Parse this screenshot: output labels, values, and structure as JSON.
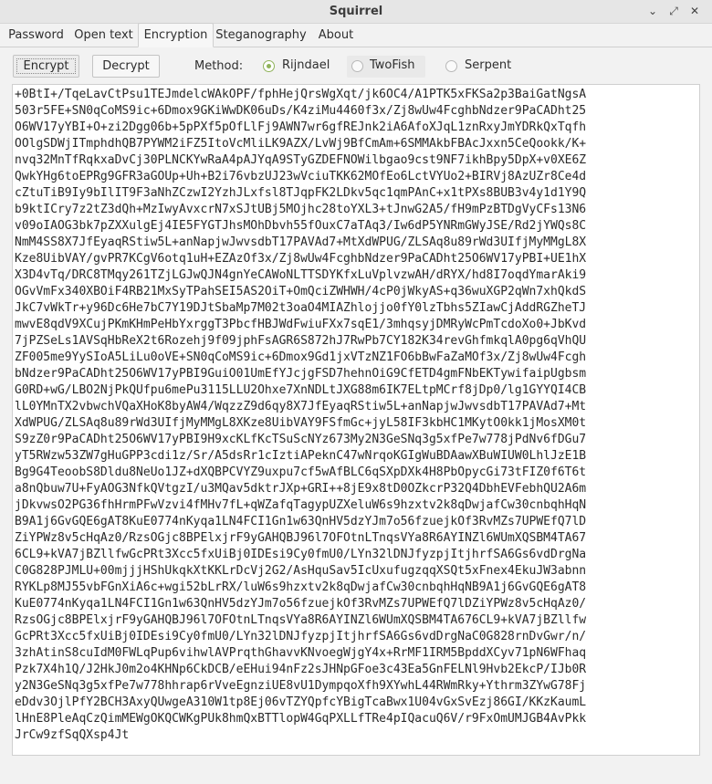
{
  "window": {
    "title": "Squirrel",
    "controls": [
      "chevron-down-icon",
      "restore-icon",
      "close-icon"
    ]
  },
  "tabs": [
    "Password",
    "Open text",
    "Encryption",
    "Steganography",
    "About"
  ],
  "active_tab": "Encryption",
  "toolbar": {
    "encrypt_label": "Encrypt",
    "decrypt_label": "Decrypt",
    "method_label": "Method:",
    "methods": [
      {
        "label": "Rijndael",
        "checked": true
      },
      {
        "label": "TwoFish",
        "checked": false
      },
      {
        "label": "Serpent",
        "checked": false
      }
    ]
  },
  "accent_color": "#8fb35a",
  "ciphertext": [
    "+0BtI+/TqeLavCtPsu1TEJmdelcWAkOPF/fphHejQrsWgXqt/jk6OC4/A1PTK5xFKSa2p3BaiGatNgsA",
    "503r5FE+SN0qCoMS9ic+6Dmox9GKiWwDK06uDs/K4ziMu4460f3x/Zj8wUw4FcghbNdzer9PaCADht25",
    "O6WV17yYBI+O+zi2Dgg06b+5pPXf5pOfLlFj9AWN7wr6gfREJnk2iA6AfoXJqL1znRxyJmYDRkQxTqfh",
    "OOlgSDWjITmphdhQB7PYWM2iFZ5ItoVcMliLK9AZX/LvWj9BfCmAm+6SMMAkbFBAcJxxn5CeQookk/K+",
    "nvq32MnTfRqkxaDvCj30PLNCKYwRaA4pAJYqA9STyGZDEFNOWilbgao9cst9NF7ikhBpy5DpX+v0XE6Z",
    "QwkYHg6toEPRg9GFR3aGOUp+Uh+B2i76vbzUJ23wVciuTKK62MOfEo6LctVYUo2+BIRVj8AzUZr8Ce4d",
    "cZtuTiB9Iy9bIlIT9F3aNhZCzwI2YzhJLxfsl8TJqpFK2LDkv5qc1qmPAnC+x1tPXs8BUB3v4y1d1Y9Q",
    "b9ktICry7z2tZ3dQh+MzIwyAvxcrN7xSJtUBj5MOjhc28toYXL3+tJnwG2A5/fH9mPzBTDgVyCFs13N6",
    "v09oIAOG3bk7pZXXulgEj4IE5FYGTJhsMOhDbvh55fOuxC7aTAq3/Iw6dP5YNRmGWyJSE/Rd2jYWQs8C",
    "NmM4SS8X7JfEyaqRStiw5L+anNapjwJwvsdbT17PAVAd7+MtXdWPUG/ZLSAq8u89rWd3UIfjMyMMgL8X",
    "Kze8UibVAY/gvPR7KCgV6otq1uH+EZAzOf3x/Zj8wUw4FcghbNdzer9PaCADht25O6WV17yPBI+UE1hX",
    "X3D4vTq/DRC8TMqy261TZjLGJwQJN4gnYeCAWoNLTTSDYKfxLuVplvzwAH/dRYX/hd8I7oqdYmarAki9",
    "OGvVmFx340XBOiF4RB21MxSyTPahSEI5AS2OiT+OmQciZWHWH/4cP0jWkyAS+q36wuXGP2qWn7xhQkdS",
    "JkC7vWkTr+y96Dc6He7bC7Y19DJtSbaMp7M02t3oaO4MIAZhlojjo0fY0lzTbhs5ZIawCjAddRGZheTJ",
    "mwvE8qdV9XCujPKmKHmPeHbYxrggT3PbcfHBJWdFwiuFXx7sqE1/3mhqsyjDMRyWcPmTcdoXo0+JbKvd",
    "7jPZSeLs1AVSqHbReX2t6Rozehj9f09jphFsAGR6S872hJ7RwPb7CY182K34revGhfmkqlA0pg6qVhQU",
    "ZF005me9YySIoA5LiLu0oVE+SN0qCoMS9ic+6Dmox9Gd1jxVTzNZ1FO6bBwFaZaMOf3x/Zj8wUw4Fcgh",
    "bNdzer9PaCADht25O6WV17yPBI9GuiO01UmEfYJcjgFSD7hehnOiG9CfETD4gmFNbEKTywifaipUgbsm",
    "G0RD+wG/LBO2NjPkQUfpu6mePu3115LLU2Ohxe7XnNDLtJXG88m6IK7ELtpMCrf8jDp0/lg1GYYQI4CB",
    "lL0YMnTX2vbwchVQaXHoK8byAW4/WqzzZ9d6qy8X7JfEyaqRStiw5L+anNapjwJwvsdbT17PAVAd7+Mt",
    "XdWPUG/ZLSAq8u89rWd3UIfjMyMMgL8XKze8UibVAY9FSfmGc+jyL58IF3kbHC1MKytO0kk1jMosXM0t",
    "S9zZ0r9PaCADht25O6WV17yPBI9H9xcKLfKcTSuScNYz673My2N3GeSNq3g5xfPe7w778jPdNv6fDGu7",
    "yT5RWzw53ZW7gHuGPP3cdi1z/Sr/A5dsRr1cIztiAPeknC47wNrqoKGIgWuBDAawXBuWIUW0LhlJzE1B",
    "Bg9G4TeoobS8Dldu8NeUo1JZ+dXQBPCVYZ9uxpu7cf5wAfBLC6qSXpDXk4H8PbOpycGi73tFIZ0f6T6t",
    "a8nQbuw7U+FyAOG3NfkQVtgzI/u3MQav5dktrJXp+GRI++8jE9x8tD0OZkcrP32Q4DbhEVFebhQU2A6m",
    "jDkvwsO2PG36fhHrmPFwVzvi4fMHv7fL+qWZafqTagypUZXeluW6s9hzxtv2k8qDwjafCw30cnbqhHqN",
    "B9A1j6GvGQE6gAT8KuE0774nKyqa1LN4FCI1Gn1w63QnHV5dzYJm7o56fzuejkOf3RvMZs7UPWEfQ7lD",
    "ZiYPWz8v5cHqAz0/RzsOGjc8BPElxjrF9yGAHQBJ96l7OFOtnLTnqsVYa8R6AYINZl6WUmXQSBM4TA67",
    "6CL9+kVA7jBZllfwGcPRt3Xcc5fxUiBj0IDEsi9Cy0fmU0/LYn32lDNJfyzpjItjhrfSA6Gs6vdDrgNa",
    "C0G828PJMLU+00mjjjHShUkqkXtKKLrDcVj2G2/AsHquSav5IcUxufugzqqXSQt5xFnex4EkuJW3abnn",
    "RYKLp8MJ55vbFGnXiA6c+wgi52bLrRX/luW6s9hzxtv2k8qDwjafCw30cnbqhHqNB9A1j6GvGQE6gAT8",
    "KuE0774nKyqa1LN4FCI1Gn1w63QnHV5dzYJm7o56fzuejkOf3RvMZs7UPWEfQ7lDZiYPWz8v5cHqAz0/",
    "RzsOGjc8BPElxjrF9yGAHQBJ96l7OFOtnLTnqsVYa8R6AYINZl6WUmXQSBM4TA676CL9+kVA7jBZllfw",
    "GcPRt3Xcc5fxUiBj0IDEsi9Cy0fmU0/LYn32lDNJfyzpjItjhrfSA6Gs6vdDrgNaC0G828rnDvGwr/n/",
    "3zhAtinS8cuIdM0FWLqPup6vihwlAVPrqthGhavvKNvoegWjgY4x+RrMF1IRM5BpddXCyv71pN6WFhaq",
    "Pzk7X4h1Q/J2HkJ0m2o4KHNp6CkDCB/eEHui94nFz2sJHNpGFoe3c43Ea5GnFELNl9Hvb2EkcP/IJb0R",
    "y2N3GeSNq3g5xfPe7w778hhrap6rVveEgnziUE8vU1DympqoXfh9XYwhL44RWmRky+Ythrm3ZYwG78Fj",
    "eDdv3OjlPfY2BCH3AxyQUwgeA310W1tp8Ej06vTZYQpfcYBigTcaBwx1U04vGxSvEzj86GI/KKzKaumL",
    "lHnE8PleAqCzQimMEWgOKQCWKgPUk8hmQxBTTlopW4GqPXLLfTRe4pIQacuQ6V/r9FxOmUMJGB4AvPkk",
    "JrCw9zfSqQXsp4Jt"
  ]
}
